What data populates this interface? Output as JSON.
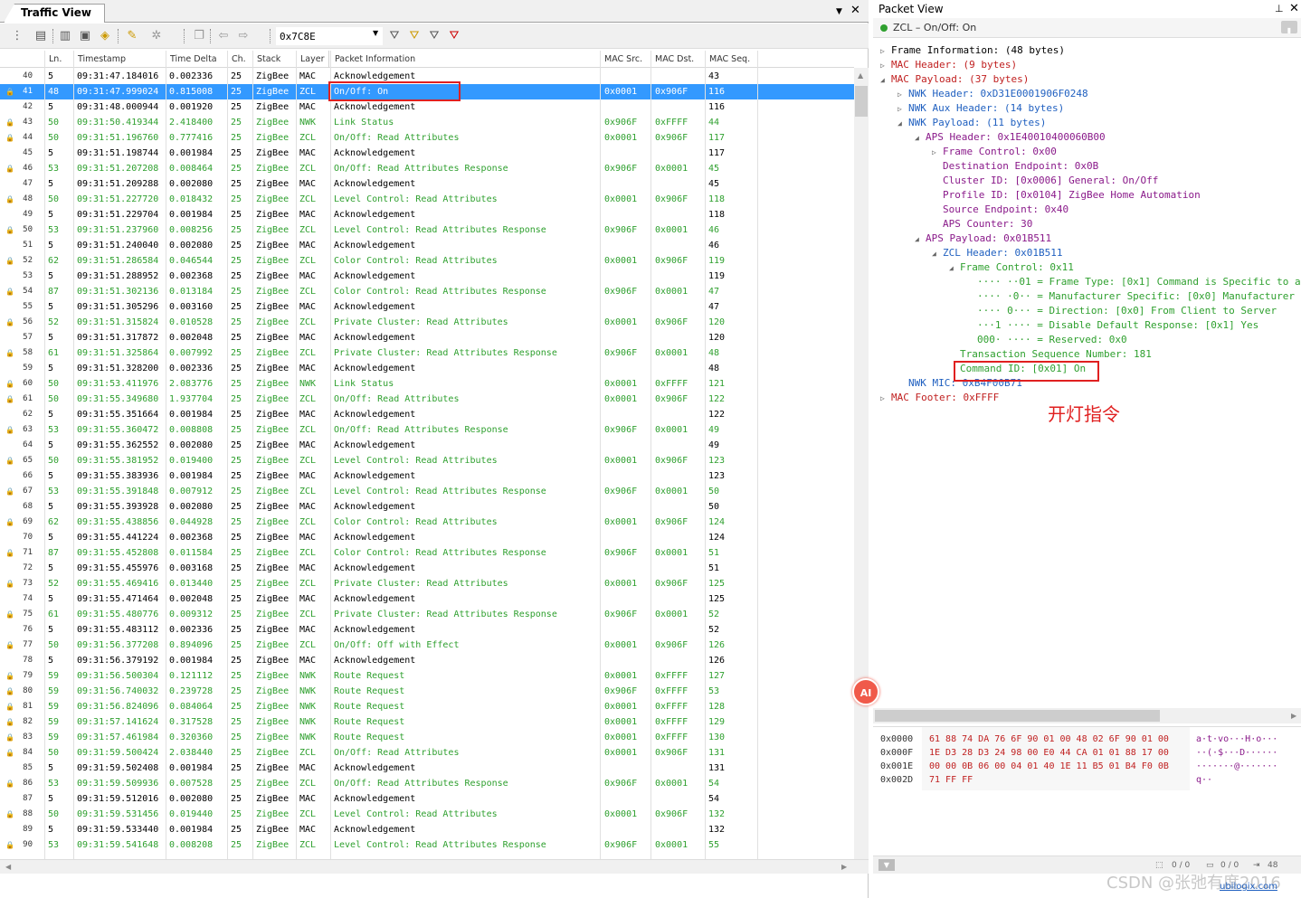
{
  "left": {
    "title": "Traffic View",
    "filter": "0x7C8E",
    "columns": [
      "Ln.",
      "Timestamp",
      "Time Delta",
      "Ch.",
      "Stack",
      "Layer",
      "Packet Information",
      "MAC Src.",
      "MAC Dst.",
      "MAC Seq."
    ],
    "rows": [
      [
        "40",
        "5",
        "09:31:47.184016",
        "0.002336",
        "25",
        "ZigBee",
        "MAC",
        "Acknowledgement",
        "",
        "",
        "43"
      ],
      [
        "41",
        "48",
        "09:31:47.999024",
        "0.815008",
        "25",
        "ZigBee",
        "ZCL",
        "On/Off: On",
        "0x0001",
        "0x906F",
        "116"
      ],
      [
        "42",
        "5",
        "09:31:48.000944",
        "0.001920",
        "25",
        "ZigBee",
        "MAC",
        "Acknowledgement",
        "",
        "",
        "116"
      ],
      [
        "43",
        "50",
        "09:31:50.419344",
        "2.418400",
        "25",
        "ZigBee",
        "NWK",
        "Link Status",
        "0x906F",
        "0xFFFF",
        "44"
      ],
      [
        "44",
        "50",
        "09:31:51.196760",
        "0.777416",
        "25",
        "ZigBee",
        "ZCL",
        "On/Off: Read Attributes",
        "0x0001",
        "0x906F",
        "117"
      ],
      [
        "45",
        "5",
        "09:31:51.198744",
        "0.001984",
        "25",
        "ZigBee",
        "MAC",
        "Acknowledgement",
        "",
        "",
        "117"
      ],
      [
        "46",
        "53",
        "09:31:51.207208",
        "0.008464",
        "25",
        "ZigBee",
        "ZCL",
        "On/Off: Read Attributes Response",
        "0x906F",
        "0x0001",
        "45"
      ],
      [
        "47",
        "5",
        "09:31:51.209288",
        "0.002080",
        "25",
        "ZigBee",
        "MAC",
        "Acknowledgement",
        "",
        "",
        "45"
      ],
      [
        "48",
        "50",
        "09:31:51.227720",
        "0.018432",
        "25",
        "ZigBee",
        "ZCL",
        "Level Control: Read Attributes",
        "0x0001",
        "0x906F",
        "118"
      ],
      [
        "49",
        "5",
        "09:31:51.229704",
        "0.001984",
        "25",
        "ZigBee",
        "MAC",
        "Acknowledgement",
        "",
        "",
        "118"
      ],
      [
        "50",
        "53",
        "09:31:51.237960",
        "0.008256",
        "25",
        "ZigBee",
        "ZCL",
        "Level Control: Read Attributes Response",
        "0x906F",
        "0x0001",
        "46"
      ],
      [
        "51",
        "5",
        "09:31:51.240040",
        "0.002080",
        "25",
        "ZigBee",
        "MAC",
        "Acknowledgement",
        "",
        "",
        "46"
      ],
      [
        "52",
        "62",
        "09:31:51.286584",
        "0.046544",
        "25",
        "ZigBee",
        "ZCL",
        "Color Control: Read Attributes",
        "0x0001",
        "0x906F",
        "119"
      ],
      [
        "53",
        "5",
        "09:31:51.288952",
        "0.002368",
        "25",
        "ZigBee",
        "MAC",
        "Acknowledgement",
        "",
        "",
        "119"
      ],
      [
        "54",
        "87",
        "09:31:51.302136",
        "0.013184",
        "25",
        "ZigBee",
        "ZCL",
        "Color Control: Read Attributes Response",
        "0x906F",
        "0x0001",
        "47"
      ],
      [
        "55",
        "5",
        "09:31:51.305296",
        "0.003160",
        "25",
        "ZigBee",
        "MAC",
        "Acknowledgement",
        "",
        "",
        "47"
      ],
      [
        "56",
        "52",
        "09:31:51.315824",
        "0.010528",
        "25",
        "ZigBee",
        "ZCL",
        "Private Cluster: Read Attributes",
        "0x0001",
        "0x906F",
        "120"
      ],
      [
        "57",
        "5",
        "09:31:51.317872",
        "0.002048",
        "25",
        "ZigBee",
        "MAC",
        "Acknowledgement",
        "",
        "",
        "120"
      ],
      [
        "58",
        "61",
        "09:31:51.325864",
        "0.007992",
        "25",
        "ZigBee",
        "ZCL",
        "Private Cluster: Read Attributes Response",
        "0x906F",
        "0x0001",
        "48"
      ],
      [
        "59",
        "5",
        "09:31:51.328200",
        "0.002336",
        "25",
        "ZigBee",
        "MAC",
        "Acknowledgement",
        "",
        "",
        "48"
      ],
      [
        "60",
        "50",
        "09:31:53.411976",
        "2.083776",
        "25",
        "ZigBee",
        "NWK",
        "Link Status",
        "0x0001",
        "0xFFFF",
        "121"
      ],
      [
        "61",
        "50",
        "09:31:55.349680",
        "1.937704",
        "25",
        "ZigBee",
        "ZCL",
        "On/Off: Read Attributes",
        "0x0001",
        "0x906F",
        "122"
      ],
      [
        "62",
        "5",
        "09:31:55.351664",
        "0.001984",
        "25",
        "ZigBee",
        "MAC",
        "Acknowledgement",
        "",
        "",
        "122"
      ],
      [
        "63",
        "53",
        "09:31:55.360472",
        "0.008808",
        "25",
        "ZigBee",
        "ZCL",
        "On/Off: Read Attributes Response",
        "0x906F",
        "0x0001",
        "49"
      ],
      [
        "64",
        "5",
        "09:31:55.362552",
        "0.002080",
        "25",
        "ZigBee",
        "MAC",
        "Acknowledgement",
        "",
        "",
        "49"
      ],
      [
        "65",
        "50",
        "09:31:55.381952",
        "0.019400",
        "25",
        "ZigBee",
        "ZCL",
        "Level Control: Read Attributes",
        "0x0001",
        "0x906F",
        "123"
      ],
      [
        "66",
        "5",
        "09:31:55.383936",
        "0.001984",
        "25",
        "ZigBee",
        "MAC",
        "Acknowledgement",
        "",
        "",
        "123"
      ],
      [
        "67",
        "53",
        "09:31:55.391848",
        "0.007912",
        "25",
        "ZigBee",
        "ZCL",
        "Level Control: Read Attributes Response",
        "0x906F",
        "0x0001",
        "50"
      ],
      [
        "68",
        "5",
        "09:31:55.393928",
        "0.002080",
        "25",
        "ZigBee",
        "MAC",
        "Acknowledgement",
        "",
        "",
        "50"
      ],
      [
        "69",
        "62",
        "09:31:55.438856",
        "0.044928",
        "25",
        "ZigBee",
        "ZCL",
        "Color Control: Read Attributes",
        "0x0001",
        "0x906F",
        "124"
      ],
      [
        "70",
        "5",
        "09:31:55.441224",
        "0.002368",
        "25",
        "ZigBee",
        "MAC",
        "Acknowledgement",
        "",
        "",
        "124"
      ],
      [
        "71",
        "87",
        "09:31:55.452808",
        "0.011584",
        "25",
        "ZigBee",
        "ZCL",
        "Color Control: Read Attributes Response",
        "0x906F",
        "0x0001",
        "51"
      ],
      [
        "72",
        "5",
        "09:31:55.455976",
        "0.003168",
        "25",
        "ZigBee",
        "MAC",
        "Acknowledgement",
        "",
        "",
        "51"
      ],
      [
        "73",
        "52",
        "09:31:55.469416",
        "0.013440",
        "25",
        "ZigBee",
        "ZCL",
        "Private Cluster: Read Attributes",
        "0x0001",
        "0x906F",
        "125"
      ],
      [
        "74",
        "5",
        "09:31:55.471464",
        "0.002048",
        "25",
        "ZigBee",
        "MAC",
        "Acknowledgement",
        "",
        "",
        "125"
      ],
      [
        "75",
        "61",
        "09:31:55.480776",
        "0.009312",
        "25",
        "ZigBee",
        "ZCL",
        "Private Cluster: Read Attributes Response",
        "0x906F",
        "0x0001",
        "52"
      ],
      [
        "76",
        "5",
        "09:31:55.483112",
        "0.002336",
        "25",
        "ZigBee",
        "MAC",
        "Acknowledgement",
        "",
        "",
        "52"
      ],
      [
        "77",
        "50",
        "09:31:56.377208",
        "0.894096",
        "25",
        "ZigBee",
        "ZCL",
        "On/Off: Off with Effect",
        "0x0001",
        "0x906F",
        "126"
      ],
      [
        "78",
        "5",
        "09:31:56.379192",
        "0.001984",
        "25",
        "ZigBee",
        "MAC",
        "Acknowledgement",
        "",
        "",
        "126"
      ],
      [
        "79",
        "59",
        "09:31:56.500304",
        "0.121112",
        "25",
        "ZigBee",
        "NWK",
        "Route Request",
        "0x0001",
        "0xFFFF",
        "127"
      ],
      [
        "80",
        "59",
        "09:31:56.740032",
        "0.239728",
        "25",
        "ZigBee",
        "NWK",
        "Route Request",
        "0x906F",
        "0xFFFF",
        "53"
      ],
      [
        "81",
        "59",
        "09:31:56.824096",
        "0.084064",
        "25",
        "ZigBee",
        "NWK",
        "Route Request",
        "0x0001",
        "0xFFFF",
        "128"
      ],
      [
        "82",
        "59",
        "09:31:57.141624",
        "0.317528",
        "25",
        "ZigBee",
        "NWK",
        "Route Request",
        "0x0001",
        "0xFFFF",
        "129"
      ],
      [
        "83",
        "59",
        "09:31:57.461984",
        "0.320360",
        "25",
        "ZigBee",
        "NWK",
        "Route Request",
        "0x0001",
        "0xFFFF",
        "130"
      ],
      [
        "84",
        "50",
        "09:31:59.500424",
        "2.038440",
        "25",
        "ZigBee",
        "ZCL",
        "On/Off: Read Attributes",
        "0x0001",
        "0x906F",
        "131"
      ],
      [
        "85",
        "5",
        "09:31:59.502408",
        "0.001984",
        "25",
        "ZigBee",
        "MAC",
        "Acknowledgement",
        "",
        "",
        "131"
      ],
      [
        "86",
        "53",
        "09:31:59.509936",
        "0.007528",
        "25",
        "ZigBee",
        "ZCL",
        "On/Off: Read Attributes Response",
        "0x906F",
        "0x0001",
        "54"
      ],
      [
        "87",
        "5",
        "09:31:59.512016",
        "0.002080",
        "25",
        "ZigBee",
        "MAC",
        "Acknowledgement",
        "",
        "",
        "54"
      ],
      [
        "88",
        "50",
        "09:31:59.531456",
        "0.019440",
        "25",
        "ZigBee",
        "ZCL",
        "Level Control: Read Attributes",
        "0x0001",
        "0x906F",
        "132"
      ],
      [
        "89",
        "5",
        "09:31:59.533440",
        "0.001984",
        "25",
        "ZigBee",
        "MAC",
        "Acknowledgement",
        "",
        "",
        "132"
      ],
      [
        "90",
        "53",
        "09:31:59.541648",
        "0.008208",
        "25",
        "ZigBee",
        "ZCL",
        "Level Control: Read Attributes Response",
        "0x906F",
        "0x0001",
        "55"
      ]
    ],
    "selected_row": "41"
  },
  "right": {
    "title": "Packet View",
    "subtitle": "ZCL – On/Off: On",
    "tree": [
      [
        "Frame Information: (48 bytes)",
        0,
        "k0",
        "closed"
      ],
      [
        "MAC Header: (9 bytes)",
        0,
        "k1",
        "closed"
      ],
      [
        "MAC Payload: (37 bytes)",
        0,
        "k1",
        "open"
      ],
      [
        "NWK Header: 0xD31E0001906F0248",
        1,
        "k2",
        "closed"
      ],
      [
        "NWK Aux Header: (14 bytes)",
        1,
        "k2",
        "closed"
      ],
      [
        "NWK Payload: (11 bytes)",
        1,
        "k2",
        "open"
      ],
      [
        "APS Header: 0x1E40010400060B00",
        2,
        "k3",
        "open"
      ],
      [
        "Frame Control: 0x00",
        3,
        "k3",
        "closed"
      ],
      [
        "Destination Endpoint: 0x0B",
        3,
        "k3",
        ""
      ],
      [
        "Cluster ID: [0x0006] General: On/Off",
        3,
        "k3",
        ""
      ],
      [
        "Profile ID: [0x0104] ZigBee Home Automation",
        3,
        "k3",
        ""
      ],
      [
        "Source Endpoint: 0x40",
        3,
        "k3",
        ""
      ],
      [
        "APS Counter: 30",
        3,
        "k3",
        ""
      ],
      [
        "APS Payload: 0x01B511",
        2,
        "k3",
        "open"
      ],
      [
        "ZCL Header: 0x01B511",
        3,
        "k2",
        "open"
      ],
      [
        "Frame Control: 0x11",
        4,
        "k4",
        "open"
      ],
      [
        "···· ··01 = Frame Type: [0x1] Command is Specific to a",
        5,
        "k4",
        ""
      ],
      [
        "···· ·0·· = Manufacturer Specific: [0x0] Manufacturer",
        5,
        "k4",
        ""
      ],
      [
        "···· 0··· = Direction: [0x0] From Client to Server",
        5,
        "k4",
        ""
      ],
      [
        "···1 ···· = Disable Default Response: [0x1] Yes",
        5,
        "k4",
        ""
      ],
      [
        "000· ···· = Reserved: 0x0",
        5,
        "k4",
        ""
      ],
      [
        "Transaction Sequence Number: 181",
        4,
        "k4",
        ""
      ],
      [
        "Command ID: [0x01] On",
        4,
        "k4",
        ""
      ],
      [
        "NWK MIC: 0xB4F00B71",
        1,
        "k2",
        ""
      ],
      [
        "MAC Footer: 0xFFFF",
        0,
        "k1",
        "closed"
      ]
    ],
    "annotation": "开灯指令",
    "hex": [
      [
        "0x0000",
        "61 88 74 DA 76 6F 90 01 00 48 02 6F 90 01 00",
        "a·t·vo···H·o···"
      ],
      [
        "0x000F",
        "1E D3 28 D3 24 98 00 E0 44 CA 01 01 88 17 00",
        "··(·$···D······"
      ],
      [
        "0x001E",
        "00 00 0B 06 00 04 01 40 1E 11 B5 01 B4 F0 0B",
        "·······@·······"
      ],
      [
        "0x002D",
        "71 FF FF",
        "q··"
      ]
    ],
    "status": [
      "0 / 0",
      "0 / 0",
      "48"
    ]
  },
  "fab_label": "AI",
  "watermark": "CSDN @张弛有度2016",
  "watermark2": "ubilogix.com"
}
